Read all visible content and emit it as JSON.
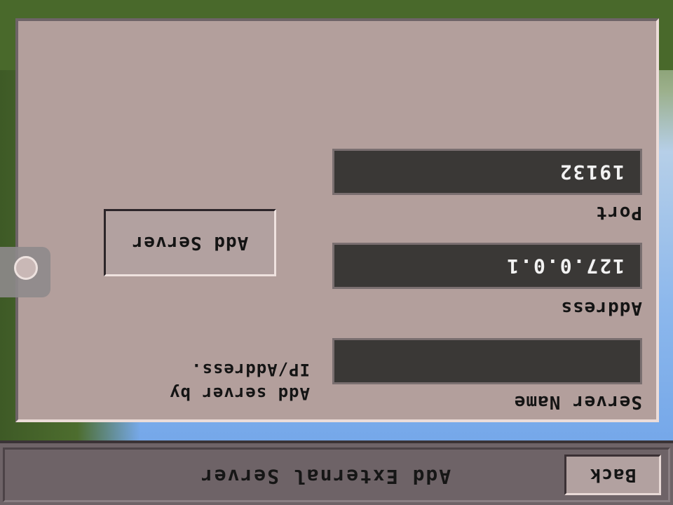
{
  "header": {
    "title": "Add External Server",
    "back_label": "Back"
  },
  "form": {
    "server_name": {
      "label": "Server Name",
      "value": ""
    },
    "address": {
      "label": "Address",
      "value": "127.0.0.1"
    },
    "port": {
      "label": "Port",
      "value": "19132"
    },
    "hint_text": "Add server by IP/Address.",
    "add_button_label": "Add Server"
  },
  "colors": {
    "panel": "#b39f9c",
    "input_background": "#3a3836",
    "button": "#b2a1a0",
    "titlebar": "#6e6367"
  },
  "screen_orientation": "rotated 180 degrees"
}
